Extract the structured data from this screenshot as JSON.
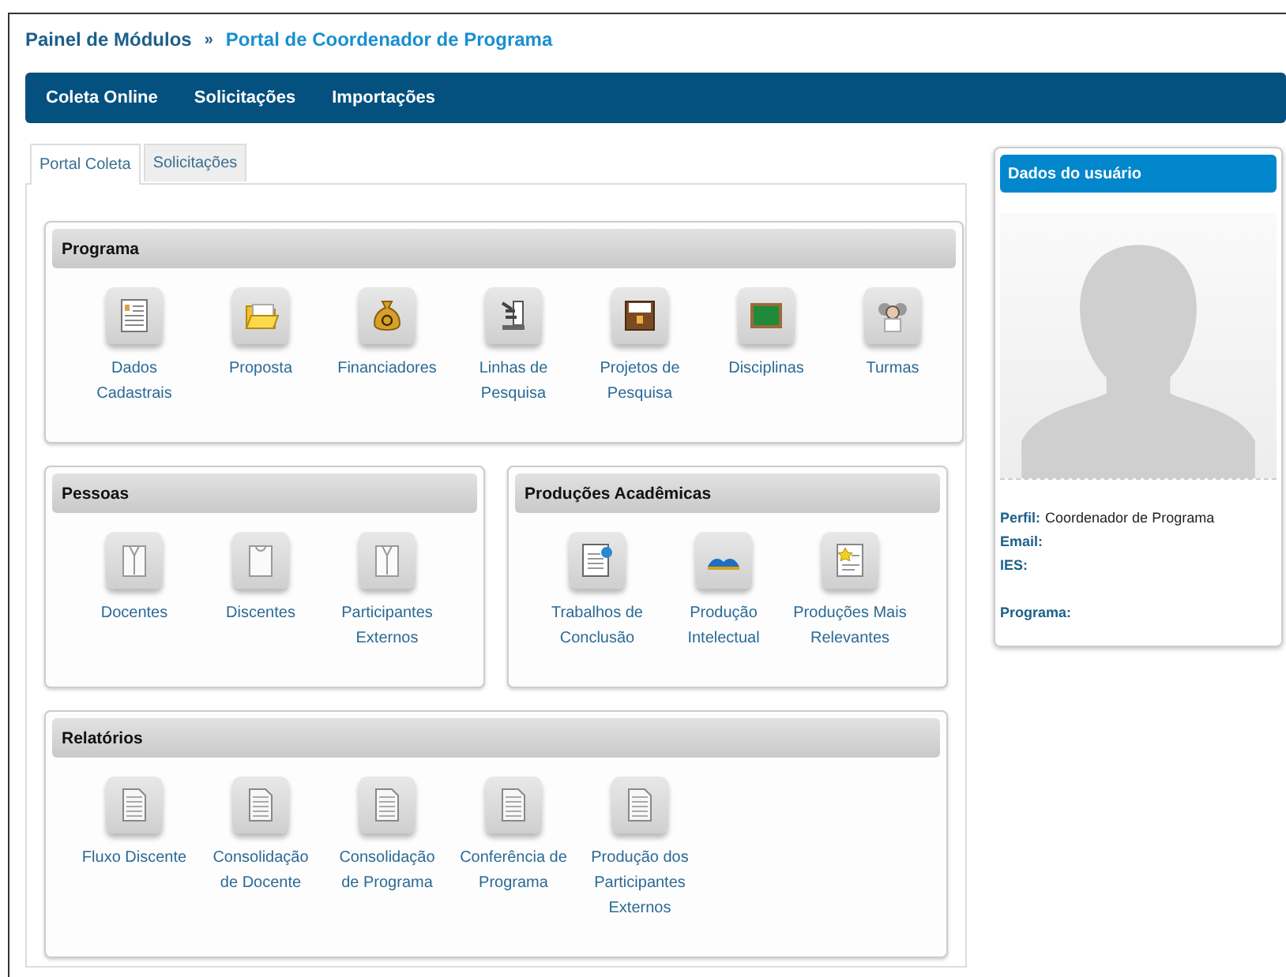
{
  "breadcrumb": {
    "root": "Painel de Módulos",
    "separator": "»",
    "current": "Portal de Coordenador de Programa"
  },
  "nav": [
    "Coleta Online",
    "Solicitações",
    "Importações"
  ],
  "tabs": [
    {
      "label": "Portal Coleta",
      "selected": true
    },
    {
      "label": "Solicitações",
      "selected": false
    }
  ],
  "section_rows": [
    {
      "sections": [
        {
          "title": "Programa",
          "items": [
            {
              "label": "Dados Cadastrais",
              "kind": "form"
            },
            {
              "label": "Proposta",
              "kind": "folder"
            },
            {
              "label": "Financiadores",
              "kind": "moneybag"
            },
            {
              "label": "Linhas de Pesquisa",
              "kind": "microscope"
            },
            {
              "label": "Projetos de Pesquisa",
              "kind": "archive"
            },
            {
              "label": "Disciplinas",
              "kind": "board"
            },
            {
              "label": "Turmas",
              "kind": "people"
            }
          ]
        }
      ]
    },
    {
      "sections": [
        {
          "title": "Pessoas",
          "items": [
            {
              "label": "Docentes",
              "kind": "jacket"
            },
            {
              "label": "Discentes",
              "kind": "shirt"
            },
            {
              "label": "Participantes Externos",
              "kind": "jacket"
            }
          ]
        },
        {
          "title": "Produções Acadêmicas",
          "items": [
            {
              "label": "Trabalhos de Conclusão",
              "kind": "certificate"
            },
            {
              "label": "Produção Intelectual",
              "kind": "book"
            },
            {
              "label": "Produções Mais Relevantes",
              "kind": "starred"
            }
          ]
        }
      ]
    },
    {
      "sections": [
        {
          "title": "Relatórios",
          "items": [
            {
              "label": "Fluxo Discente",
              "kind": "report"
            },
            {
              "label": "Consolidação de Docente",
              "kind": "report"
            },
            {
              "label": "Consolidação de Programa",
              "kind": "report"
            },
            {
              "label": "Conferência de Programa",
              "kind": "report"
            },
            {
              "label": "Produção dos Participantes Externos",
              "kind": "report"
            }
          ]
        }
      ]
    }
  ],
  "user_card": {
    "title": "Dados do usuário",
    "fields": [
      {
        "label": "Perfil:",
        "value": "Coordenador de Programa"
      },
      {
        "label": "Email:"
      },
      {
        "label": "IES:"
      },
      {
        "label": "Programa:"
      }
    ]
  }
}
